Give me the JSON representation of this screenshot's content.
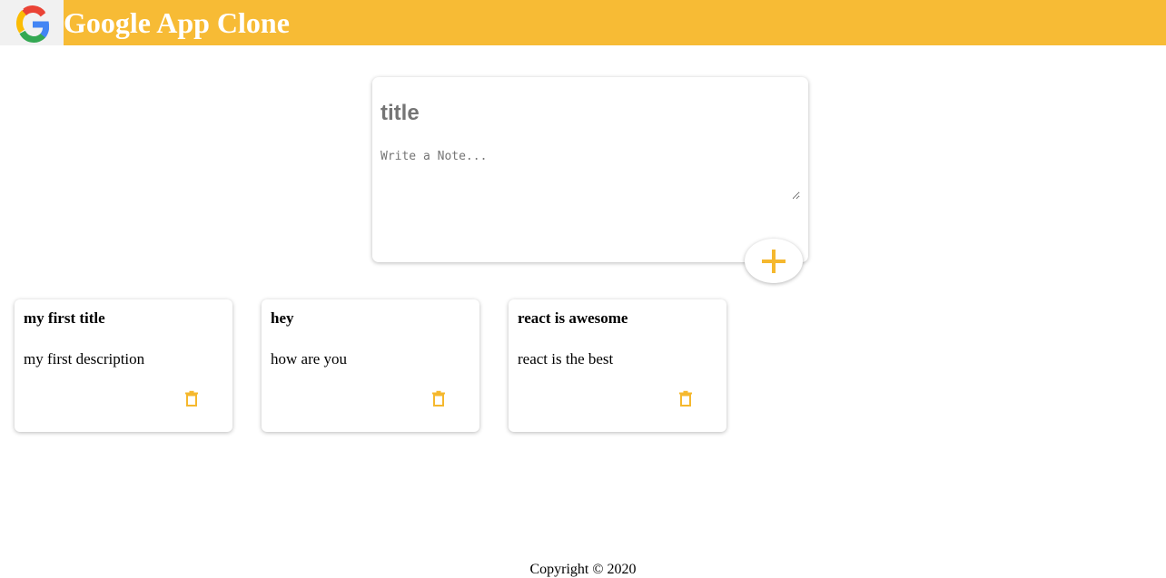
{
  "header": {
    "title": "Google App Clone",
    "logo_icon": "google-g-logo",
    "bg_color": "#f7bb35"
  },
  "composer": {
    "title_placeholder": "title",
    "note_placeholder": "Write a Note...",
    "add_icon": "plus-icon",
    "accent_color": "#f5b82e"
  },
  "notes": [
    {
      "title": "my first title",
      "content": "my first description",
      "delete_icon": "trash-icon"
    },
    {
      "title": "hey",
      "content": "how are you",
      "delete_icon": "trash-icon"
    },
    {
      "title": "react is awesome",
      "content": "react is the best",
      "delete_icon": "trash-icon"
    }
  ],
  "footer": {
    "text": "Copyright © 2020"
  }
}
